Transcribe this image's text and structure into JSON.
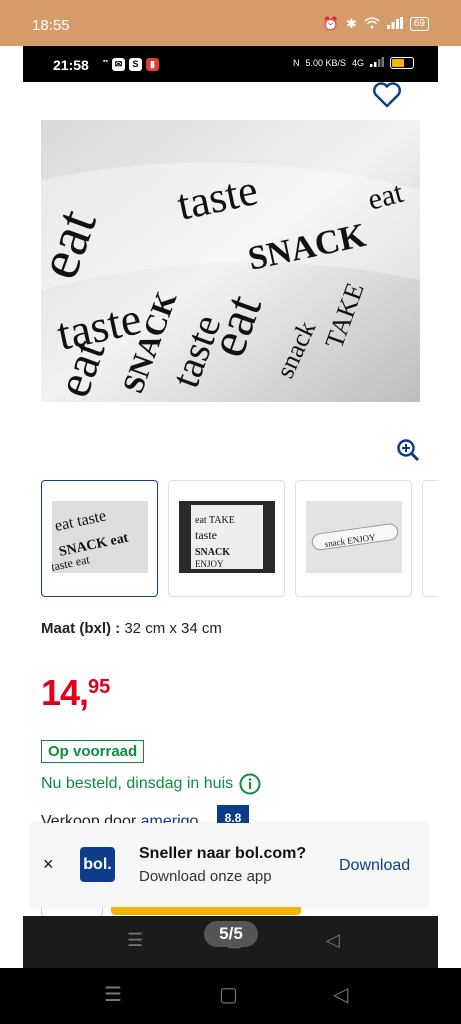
{
  "outer_status": {
    "time": "18:55",
    "battery": "69"
  },
  "inner_status": {
    "time": "21:58",
    "network_speed": "5.00 KB/S",
    "signal": "4G"
  },
  "product": {
    "image_words": [
      "eat",
      "taste",
      "SNACK",
      "eat",
      "taste",
      "TAKE",
      "snack",
      "eat",
      "taste",
      "SNACK",
      "eat"
    ],
    "thumbnails": [
      {
        "name": "thumbnail-1",
        "active": true
      },
      {
        "name": "thumbnail-2",
        "active": false
      },
      {
        "name": "thumbnail-3",
        "active": false
      }
    ],
    "size_label": "Maat (bxl) :",
    "size_value": "32 cm x 34 cm",
    "price_main": "14,",
    "price_cents": "95",
    "stock_label": "Op voorraad",
    "delivery_text": "Nu besteld, dinsdag in huis",
    "seller_prefix": "Verkoop door",
    "seller_name": "amerigo",
    "seller_rating": "8.8"
  },
  "app_banner": {
    "close": "×",
    "logo_text": "bol.",
    "title": "Sneller naar bol.com?",
    "subtitle": "Download onze app",
    "action": "Download"
  },
  "image_counter": "5/5",
  "colors": {
    "brand_blue": "#0f3c8a",
    "price_red": "#e0001b",
    "stock_green": "#0a8f3c",
    "accent_yellow": "#f5b400",
    "status_bar": "#d59b68"
  }
}
